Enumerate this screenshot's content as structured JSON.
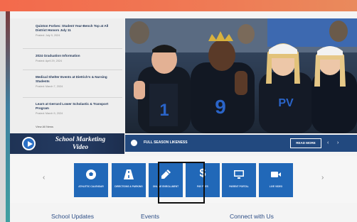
{
  "news": {
    "items": [
      {
        "title": "Quinton Forbes: Student Year-Bench Top at All District Honors July 11",
        "date": "Posted: July 9, 2024"
      },
      {
        "title": "2024 Graduation Information",
        "date": "Posted: April 29, 2024"
      },
      {
        "title": "Medical Shelter Events at Dietrich's & Nursing Students",
        "date": "Posted: March 7, 2024"
      },
      {
        "title": "Learn at Gerrard Lower Scholastic & Transport Program",
        "date": "Posted: March 9, 2024"
      }
    ],
    "view_all": "View All News"
  },
  "video_promo": {
    "line1": "School Marketing",
    "line2": "Video"
  },
  "hero": {
    "caption": "FULL SEASON LIKENESS",
    "button_label": "READ MORE",
    "prev_glyph": "‹",
    "next_glyph": "›",
    "jersey_numbers": [
      "1",
      "9"
    ],
    "shirt_text": "PV"
  },
  "quick_links": {
    "prev_glyph": "‹",
    "next_glyph": "›",
    "items": [
      {
        "icon": "soccer-ball-icon",
        "label": "ATHLETIC CALENDAR",
        "glyph": ""
      },
      {
        "icon": "road-icon",
        "label": "DIRECTIONS & PARKING",
        "glyph": ""
      },
      {
        "icon": "pencil-icon",
        "label": "ONLINE ENROLLMENT",
        "glyph": ""
      },
      {
        "icon": "dollar-icon",
        "label": "PAY FEES",
        "glyph": "$"
      },
      {
        "icon": "monitor-icon",
        "label": "PARENT PORTAL",
        "glyph": ""
      },
      {
        "icon": "video-camera-icon",
        "label": "LIVE VIDEO",
        "glyph": ""
      }
    ]
  },
  "sections": {
    "school_updates": "School Updates",
    "events": "Events",
    "connect": "Connect with Us"
  },
  "colors": {
    "brand_blue": "#2168b8",
    "navy": "#22497f",
    "top_band": "#f36a4c"
  }
}
